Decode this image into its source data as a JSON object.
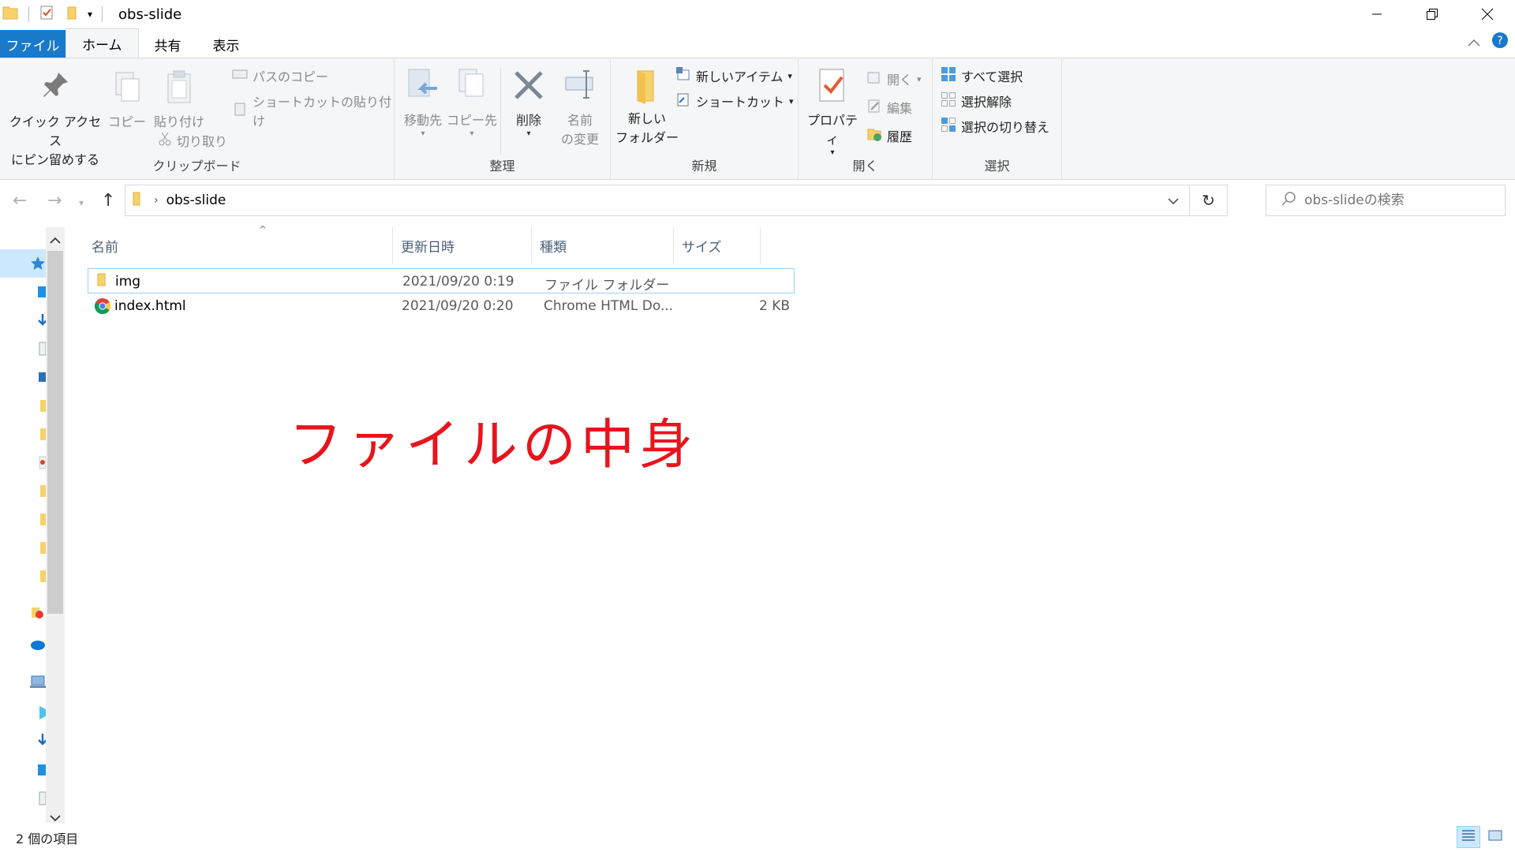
{
  "window": {
    "title": "obs-slide",
    "controls": [
      "minimize-icon",
      "restore-icon",
      "close-icon"
    ]
  },
  "ribbon_tabs": [
    {
      "label": "ファイル",
      "active": false
    },
    {
      "label": "ホーム",
      "active": true
    },
    {
      "label": "共有",
      "active": false
    },
    {
      "label": "表示",
      "active": false
    }
  ],
  "ribbon": {
    "clipboard": {
      "label": "クリップボード",
      "pin_line1": "クイック アクセス",
      "pin_line2": "にピン留めする",
      "copy": "コピー",
      "paste": "貼り付け",
      "copy_path": "パスのコピー",
      "paste_shortcut": "ショートカットの貼り付け",
      "cut": "切り取り"
    },
    "organize": {
      "label": "整理",
      "move_to": "移動先",
      "copy_to": "コピー先",
      "delete": "削除",
      "rename_line1": "名前",
      "rename_line2": "の変更"
    },
    "new": {
      "label": "新規",
      "new_folder_line1": "新しい",
      "new_folder_line2": "フォルダー",
      "new_item": "新しいアイテム",
      "easy_access": "ショートカット"
    },
    "open": {
      "label": "開く",
      "properties": "プロパティ",
      "open": "開く",
      "edit": "編集",
      "history": "履歴"
    },
    "select": {
      "label": "選択",
      "select_all": "すべて選択",
      "select_none": "選択解除",
      "invert": "選択の切り替え"
    }
  },
  "address": {
    "path": "obs-slide",
    "search_placeholder": "obs-slideの検索"
  },
  "columns": [
    "名前",
    "更新日時",
    "種類",
    "サイズ"
  ],
  "files": [
    {
      "name": "img",
      "modified": "2021/09/20 0:19",
      "type": "ファイル フォルダー",
      "size": "",
      "icon": "folder-icon",
      "selected": true
    },
    {
      "name": "index.html",
      "modified": "2021/09/20 0:20",
      "type": "Chrome HTML Do...",
      "size": "2 KB",
      "icon": "chrome-icon",
      "selected": false
    }
  ],
  "annotation": "ファイルの中身",
  "status": {
    "item_count": "2 個の項目"
  },
  "colors": {
    "file_tab": "#1979ca",
    "annotation": "#e8141c",
    "selection_border": "#99d1ff"
  }
}
